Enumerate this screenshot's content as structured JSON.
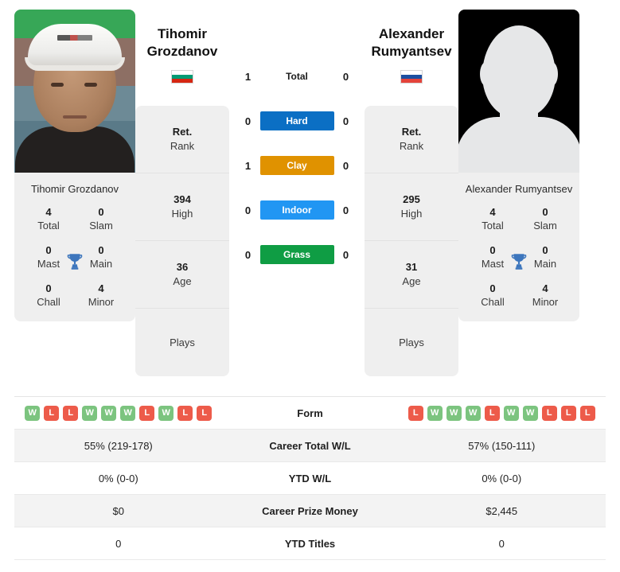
{
  "players": {
    "left": {
      "name": "Tihomir Grozdanov",
      "first_name": "Tihomir",
      "last_name": "Grozdanov",
      "card_name": "Tihomir Grozdanov",
      "country": "Bulgaria",
      "flag_icon": "flag-bulgaria",
      "photo_type": "player-photo",
      "titles": [
        {
          "value": "4",
          "label": "Total"
        },
        {
          "value": "0",
          "label": "Slam"
        },
        {
          "value": "0",
          "label": "Mast"
        },
        {
          "value": "0",
          "label": "Main"
        },
        {
          "value": "0",
          "label": "Chall"
        },
        {
          "value": "4",
          "label": "Minor"
        }
      ],
      "ranks": [
        {
          "value": "Ret.",
          "label": "Rank"
        },
        {
          "value": "394",
          "label": "High"
        },
        {
          "value": "36",
          "label": "Age"
        },
        {
          "value": "",
          "label": "Plays"
        }
      ],
      "form": [
        "W",
        "L",
        "L",
        "W",
        "W",
        "W",
        "L",
        "W",
        "L",
        "L"
      ],
      "career_total_wl": "55% (219-178)",
      "ytd_wl": "0% (0-0)",
      "career_prize_money": "$0",
      "ytd_titles": "0"
    },
    "right": {
      "name": "Alexander Rumyantsev",
      "first_name": "Alexander",
      "last_name": "Rumyantsev",
      "card_name": "Alexander Rumyantsev",
      "country": "Russia",
      "flag_icon": "flag-russia",
      "photo_type": "silhouette-avatar",
      "titles": [
        {
          "value": "4",
          "label": "Total"
        },
        {
          "value": "0",
          "label": "Slam"
        },
        {
          "value": "0",
          "label": "Mast"
        },
        {
          "value": "0",
          "label": "Main"
        },
        {
          "value": "0",
          "label": "Chall"
        },
        {
          "value": "4",
          "label": "Minor"
        }
      ],
      "ranks": [
        {
          "value": "Ret.",
          "label": "Rank"
        },
        {
          "value": "295",
          "label": "High"
        },
        {
          "value": "31",
          "label": "Age"
        },
        {
          "value": "",
          "label": "Plays"
        }
      ],
      "form": [
        "L",
        "W",
        "W",
        "W",
        "L",
        "W",
        "W",
        "L",
        "L",
        "L"
      ],
      "career_total_wl": "57% (150-111)",
      "ytd_wl": "0% (0-0)",
      "career_prize_money": "$2,445",
      "ytd_titles": "0"
    }
  },
  "head_to_head": [
    {
      "label": "Total",
      "left": "1",
      "right": "0",
      "color": "",
      "plain": true
    },
    {
      "label": "Hard",
      "left": "0",
      "right": "0",
      "color": "#0b6fc4",
      "plain": false
    },
    {
      "label": "Clay",
      "left": "1",
      "right": "0",
      "color": "#e09200",
      "plain": false
    },
    {
      "label": "Indoor",
      "left": "0",
      "right": "0",
      "color": "#2196f3",
      "plain": false
    },
    {
      "label": "Grass",
      "left": "0",
      "right": "0",
      "color": "#0f9d44",
      "plain": false
    }
  ],
  "stats_table": [
    {
      "label": "Form",
      "left": "",
      "right": "",
      "type": "form",
      "alt": false
    },
    {
      "label": "Career Total W/L",
      "left": "55% (219-178)",
      "right": "57% (150-111)",
      "type": "text",
      "alt": true
    },
    {
      "label": "YTD W/L",
      "left": "0% (0-0)",
      "right": "0% (0-0)",
      "type": "text",
      "alt": false
    },
    {
      "label": "Career Prize Money",
      "left": "$0",
      "right": "$2,445",
      "type": "text",
      "alt": true
    },
    {
      "label": "YTD Titles",
      "left": "0",
      "right": "0",
      "type": "text",
      "alt": false
    }
  ],
  "colors": {
    "hard": "#0b6fc4",
    "clay": "#e09200",
    "indoor": "#2196f3",
    "grass": "#0f9d44",
    "win": "#7cc47f",
    "loss": "#ed5b4a",
    "trophy": "#3d76bd",
    "card_bg": "#efefef"
  },
  "flags": {
    "bulgaria": [
      "#ffffff",
      "#009b74",
      "#d62612"
    ],
    "russia": [
      "#ffffff",
      "#1b4fa0",
      "#e4433a"
    ]
  }
}
